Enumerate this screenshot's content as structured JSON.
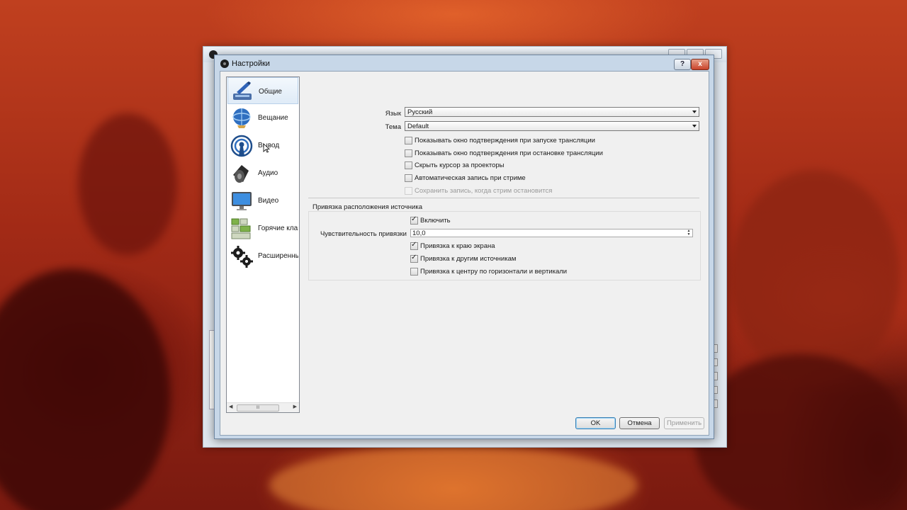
{
  "window": {
    "title": "Настройки",
    "help_label": "?",
    "close_label": "x"
  },
  "sidebar": {
    "items": [
      {
        "label": "Общие",
        "icon": "general-settings-icon",
        "selected": true
      },
      {
        "label": "Вещание",
        "icon": "broadcast-globe-icon",
        "selected": false
      },
      {
        "label": "Вывод",
        "icon": "output-broadcast-icon",
        "selected": false
      },
      {
        "label": "Аудио",
        "icon": "speaker-icon",
        "selected": false
      },
      {
        "label": "Видео",
        "icon": "monitor-icon",
        "selected": false
      },
      {
        "label": "Горячие клав",
        "icon": "keyboard-icon",
        "selected": false
      },
      {
        "label": "Расширенны",
        "icon": "gears-icon",
        "selected": false
      }
    ],
    "scrollbar_thumb": "III"
  },
  "general": {
    "language_label": "Язык",
    "language_value": "Русский",
    "theme_label": "Тема",
    "theme_value": "Default",
    "checkboxes": [
      {
        "label": "Показывать окно подтверждения при запуске трансляции",
        "checked": false,
        "disabled": false
      },
      {
        "label": "Показывать окно подтверждения при остановке трансляции",
        "checked": false,
        "disabled": false
      },
      {
        "label": "Скрыть курсор за проекторы",
        "checked": false,
        "disabled": false
      },
      {
        "label": "Автоматическая запись при стриме",
        "checked": false,
        "disabled": false
      },
      {
        "label": "Сохранить запись, когда стрим остановится",
        "checked": false,
        "disabled": true
      }
    ]
  },
  "snapping": {
    "group_title": "Привязка расположения источника",
    "enable_label": "Включить",
    "enable_checked": true,
    "sensitivity_label": "Чувствительность привязки",
    "sensitivity_value": "10,0",
    "options": [
      {
        "label": "Привязка к краю экрана",
        "checked": true
      },
      {
        "label": "Привязка к другим источникам",
        "checked": true
      },
      {
        "label": "Привязка к центру по горизонтали и вертикали",
        "checked": false
      }
    ]
  },
  "buttons": {
    "ok": "OK",
    "cancel": "Отмена",
    "apply": "Применить"
  },
  "colors": {
    "dialog_frame": "#c7d7e8",
    "client_bg": "#f0f0f0",
    "default_button_border": "#3c7fb1"
  }
}
